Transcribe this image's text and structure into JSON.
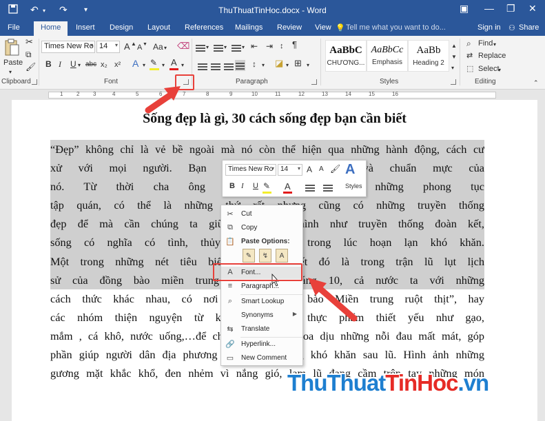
{
  "titlebar": {
    "doc_title": "ThuThuatTinHoc.docx - Word",
    "save_icon": "save-icon",
    "undo_icon": "undo-icon",
    "redo_icon": "redo-icon"
  },
  "tabs": [
    "File",
    "Home",
    "Insert",
    "Design",
    "Layout",
    "References",
    "Mailings",
    "Review",
    "View"
  ],
  "tell_me": "Tell me what you want to do...",
  "account": {
    "sign_in": "Sign in",
    "share": "Share"
  },
  "ribbon": {
    "paste_label": "Paste",
    "groups": {
      "clipboard": "Clipboard",
      "font": "Font",
      "paragraph": "Paragraph",
      "styles": "Styles",
      "editing": "Editing"
    },
    "font_name": "Times New Ro",
    "font_size": "14",
    "grow_font": "A",
    "shrink_font": "A",
    "change_case": "Aa",
    "bold": "B",
    "italic": "I",
    "underline": "U",
    "strike": "abc",
    "subscript": "x₂",
    "superscript": "x²",
    "font_color": "A",
    "styles": [
      {
        "sample": "AaBbC",
        "name": "CHƯƠNG..."
      },
      {
        "sample": "AaBbCc",
        "name": "Emphasis"
      },
      {
        "sample": "AaBb",
        "name": "Heading 2"
      }
    ],
    "editing": {
      "find": "Find",
      "replace": "Replace",
      "select": "Select"
    }
  },
  "ruler_numbers": [
    "1",
    "2",
    "3",
    "4",
    "5",
    "6",
    "7",
    "8",
    "9",
    "10",
    "11",
    "12",
    "13",
    "14",
    "15",
    "16"
  ],
  "document": {
    "title": "Sống đẹp là gì, 30 cách sống đẹp bạn cần biết",
    "lines": [
      " “Đẹp” không chỉ là vẻ bề ngoài mà nó còn thể hiện qua những hành động, cách cư",
      "xử với mọi người. Bạn biết đấy, c                                   y tắc và chuẩn mực của",
      "nó. Từ thời cha ông ta ngày xưa                                 ruyền những phong tục",
      "tập quán, có thể là những thứ rất               nhưng cũng có những truyền thống",
      "đẹp để mà cần chúng ta giữ gìn v               ển hình như truyền thống đoàn kết,",
      "sống có nghĩa có tình, thủy chung              nhau trong lúc hoạn lạn khó khăn.",
      "Một trong những nét tiêu biểu ch               đoàn kết đó là trong trận lũ lụt lịch",
      "sử của đồng bào miền trung trong               uối tháng 10, cả nước ta với những",
      "cách thức khác nhau, có nơi gây q               đồng bào Miền trung ruột thịt”, hay",
      "các nhóm thiện nguyện từ khắp n               những thực phẩm thiết yếu như gạo,",
      "mắm , cá khô, nước uống,…để chung tay nhằm xoa dịu những nỗi đau mất mát, góp",
      "phần giúp người dân địa phương vượt qua những khó khăn sau lũ. Hình ảnh những",
      "gương mặt khắc khổ, đen nhẻm vì nắng gió, lam lũ đang cầm trên tay những món"
    ]
  },
  "mini_toolbar": {
    "font_name": "Times New Ro",
    "font_size": "14",
    "grow": "A",
    "shrink": "A",
    "bold": "B",
    "italic": "I",
    "underline": "U",
    "font_color": "A",
    "styles_label": "Styles"
  },
  "context_menu": {
    "cut": "Cut",
    "copy": "Copy",
    "paste_options": "Paste Options:",
    "font": "Font...",
    "paragraph": "Paragraph...",
    "smart_lookup": "Smart Lookup",
    "synonyms": "Synonyms",
    "translate": "Translate",
    "hyperlink": "Hyperlink...",
    "new_comment": "New Comment"
  },
  "watermark": {
    "part1": "ThuThuat",
    "part2": "TinHoc",
    "part3": ".vn"
  },
  "colors": {
    "accent": "#2b579a",
    "highlight_red": "#e8403a",
    "selection": "#cfcfcf"
  }
}
